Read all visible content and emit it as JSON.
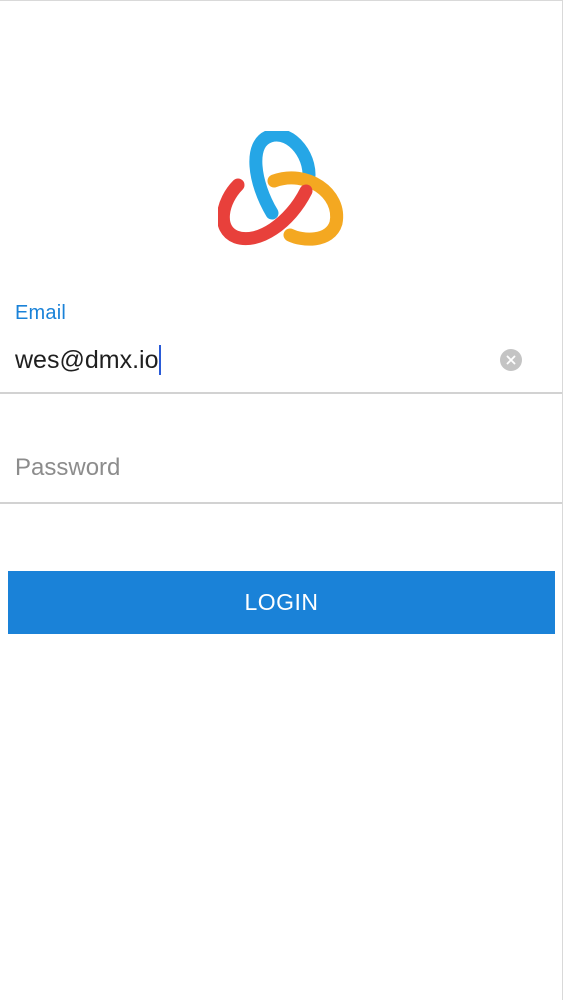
{
  "logo": {
    "icon": "tri-arc-logo-icon",
    "colors": {
      "blue": "#25a6e6",
      "yellow": "#f4a821",
      "red": "#e8403b"
    }
  },
  "form": {
    "email": {
      "label": "Email",
      "value": "wes@dmx.io",
      "clear_icon": "clear-circle-icon"
    },
    "password": {
      "placeholder": "Password",
      "value": ""
    },
    "login_label": "LOGIN"
  },
  "colors": {
    "accent": "#1a82d8",
    "placeholder": "#8c8c8c",
    "divider": "#d2d2d2"
  }
}
